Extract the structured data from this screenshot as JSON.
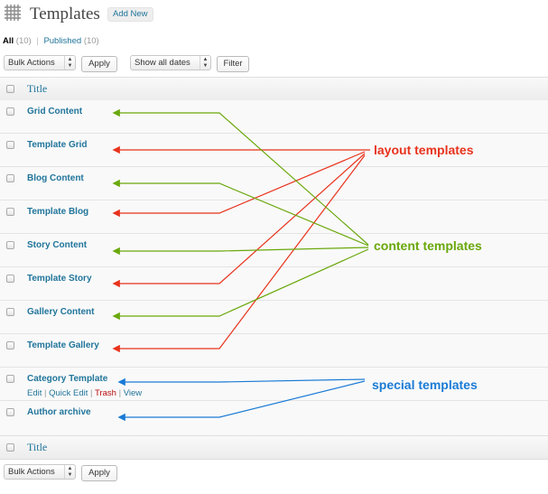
{
  "header": {
    "title": "Templates",
    "add_new_label": "Add New"
  },
  "filters": {
    "all_label": "All",
    "all_count": "(10)",
    "separator": "|",
    "published_label": "Published",
    "published_count": "(10)"
  },
  "top_actions": {
    "bulk_actions": "Bulk Actions",
    "apply_label": "Apply",
    "dates": "Show all dates",
    "filter_label": "Filter"
  },
  "table": {
    "column_title": "Title",
    "rows": [
      {
        "title": "Grid Content"
      },
      {
        "title": "Template Grid"
      },
      {
        "title": "Blog Content"
      },
      {
        "title": "Template Blog"
      },
      {
        "title": "Story Content"
      },
      {
        "title": "Template Story"
      },
      {
        "title": "Gallery Content"
      },
      {
        "title": "Template Gallery"
      },
      {
        "title": "Category Template",
        "actions": [
          "Edit",
          "Quick Edit",
          "Trash",
          "View"
        ]
      },
      {
        "title": "Author archive"
      }
    ]
  },
  "bottom_actions": {
    "bulk_actions": "Bulk Actions",
    "apply_label": "Apply"
  },
  "annotations": {
    "layout": {
      "label": "layout templates",
      "color": "#e8321c"
    },
    "content": {
      "label": "content templates",
      "color": "#6aa80c"
    },
    "special": {
      "label": "special templates",
      "color": "#1a7bd6"
    }
  },
  "colors": {
    "link": "#21759b",
    "trash": "#bc0b0b"
  }
}
